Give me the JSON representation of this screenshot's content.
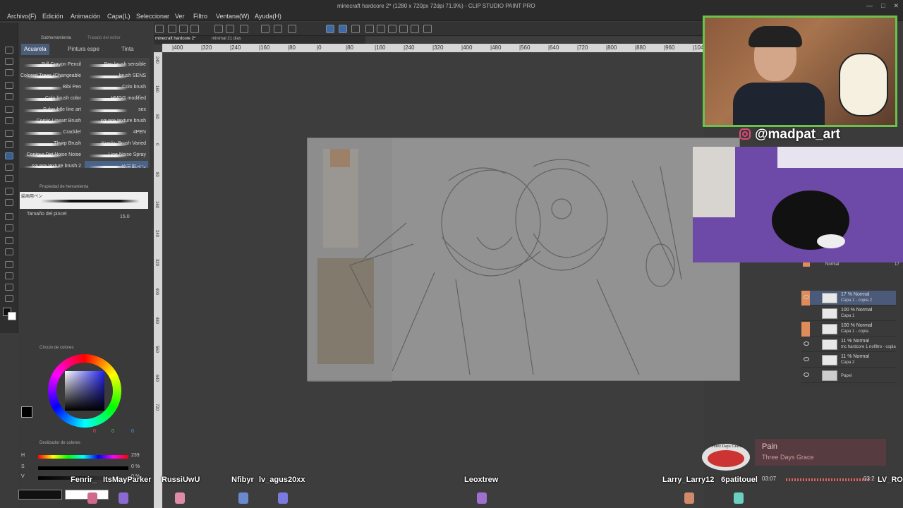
{
  "window": {
    "title": "minecraft hardcore 2* (1280 x 720px 72dpi 71.9%)  - CLIP STUDIO PAINT PRO",
    "controls": [
      "—",
      "□",
      "✕"
    ]
  },
  "menu": [
    "Archivo(F)",
    "Edición",
    "Animación",
    "Capa(L)",
    "Seleccionar",
    "Ver",
    "Filtro",
    "Ventana(W)",
    "Ayuda(H)"
  ],
  "left_panel": {
    "top_tabs": [
      "Subherramienta",
      "Tratado del editor"
    ],
    "subtool_tabs": [
      "Acuarela",
      "Pintura espe",
      "Tinta"
    ],
    "brushes_left": [
      "Still Crayon Pencil",
      "Colored Trees (Changeable",
      "Bibi Pen",
      "Colo brush color",
      "Subsubtle line art",
      "Comic Lineart Brush",
      "Crackle!",
      "Thwip Brush",
      "Contour Dirt Noise Noise",
      "square texture brush 2"
    ],
    "brushes_right": [
      "Pen brush sensible",
      "brush SENS",
      "Colo brush",
      "HMGG modified",
      "sex",
      "square texture brush",
      "4PEN",
      "Kracky Brush Varied",
      "Line Noise Spray",
      "絵画用ペン"
    ],
    "tool_property_header": "Propiedad de herramienta",
    "tool_property_preset": "絵画用ペン",
    "brush_size_label": "Tamaño del pincel",
    "brush_size_value": "15.0"
  },
  "color_panel": {
    "header": "Círculo de colores",
    "rgb": [
      "0",
      "0",
      "0"
    ]
  },
  "slider_panel": {
    "header": "Deslizador de colores",
    "h_label": "H",
    "h_value": "239",
    "s_label": "S",
    "s_value": "0 %",
    "v_label": "V",
    "v_value": "0 %"
  },
  "doc_tabs": [
    "minecraft hardcore 2*",
    "minimal 21 dias"
  ],
  "ruler_ticks": [
    "|400",
    "|320",
    "|240",
    "|160",
    "|80",
    "|0",
    "|80",
    "|160",
    "|240",
    "|320",
    "|400",
    "|480",
    "|560",
    "|640",
    "|720",
    "|800",
    "|880",
    "|960",
    "|1040",
    "|1120"
  ],
  "vruler_ticks": [
    "240",
    "160",
    "80",
    "0",
    "80",
    "160",
    "240",
    "320",
    "400",
    "480",
    "560",
    "640",
    "720"
  ],
  "overlay": {
    "handle": "@madpat_art"
  },
  "layers": {
    "blend_mode": "Normal",
    "opacity_value": "17",
    "items": [
      {
        "line1": "17 % Normal",
        "line2": "Capa 1 - copia 2",
        "selected": true
      },
      {
        "line1": "100 % Normal",
        "line2": "Capa 1",
        "selected": false
      },
      {
        "line1": "100 % Normal",
        "line2": "Capa 1 - copia",
        "selected": false
      },
      {
        "line1": "11 % Normal",
        "line2": "mc hardcore 1 nofiltro - copia",
        "selected": false
      },
      {
        "line1": "11 % Normal",
        "line2": "Capa 2",
        "selected": false
      },
      {
        "line1": "",
        "line2": "Papel",
        "selected": false
      }
    ]
  },
  "chat_names": [
    "Fenrir_",
    "ItsMayParker",
    "RussiUwU",
    "Nfibyr",
    "lv_agus20xx",
    "Leoxtrew",
    "Larry_Larry12",
    "6patitouel",
    "LV_ROI"
  ],
  "now_playing": {
    "title": "Pain",
    "artist": "Three Days Grace",
    "album_text": "Three Days Grace",
    "elapsed": "03:07",
    "total": "03:2"
  },
  "colors": {
    "accent": "#4b5d78",
    "webcam_border": "#6bc24a",
    "layer_lock": "#e08c5a"
  }
}
